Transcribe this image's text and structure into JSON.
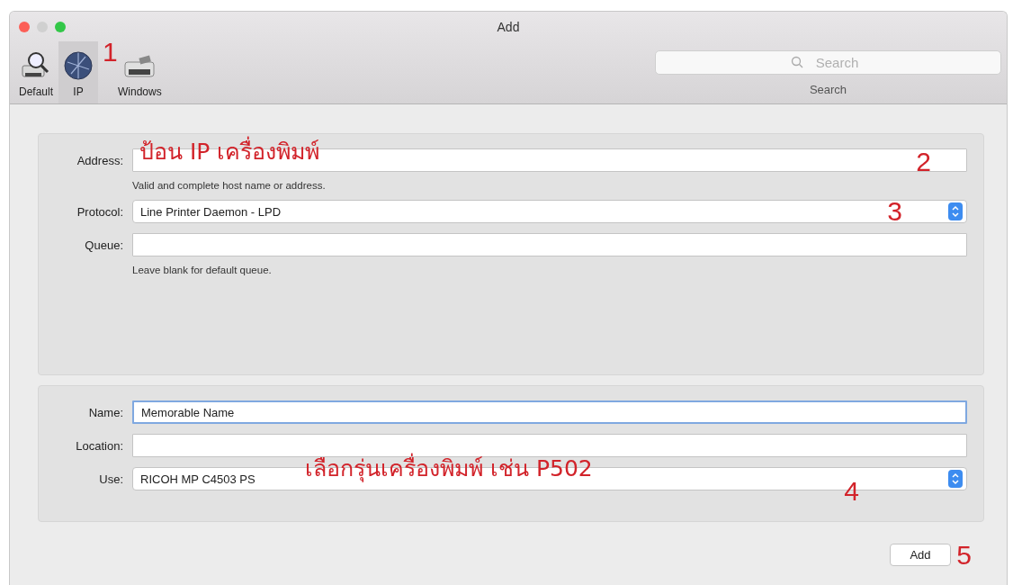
{
  "window": {
    "title": "Add"
  },
  "toolbar": {
    "marker": "1",
    "items": [
      {
        "kind": "default",
        "label": "Default",
        "selected": false
      },
      {
        "kind": "ip",
        "label": "IP",
        "selected": true
      },
      {
        "kind": "windows",
        "label": "Windows",
        "selected": false
      }
    ]
  },
  "search": {
    "placeholder": "Search",
    "label": "Search"
  },
  "connection": {
    "fields": [
      {
        "kind": "text",
        "label": "Address:",
        "focused": false,
        "hint": "Valid and complete host name or address.",
        "note": "ป้อน IP เครื่องพิมพ์",
        "marker": "2"
      },
      {
        "kind": "select",
        "label": "Protocol:",
        "value": "Line Printer Daemon - LPD",
        "focused": false,
        "marker": "3"
      },
      {
        "kind": "text",
        "label": "Queue:",
        "focused": false,
        "hint": "Leave blank for default queue."
      }
    ]
  },
  "details": {
    "fields": [
      {
        "kind": "text",
        "label": "Name:",
        "value": "Memorable Name",
        "focused": true
      },
      {
        "kind": "text",
        "label": "Location:",
        "focused": false
      },
      {
        "kind": "select",
        "label": "Use:",
        "value": "RICOH MP C4503 PS",
        "focused": false,
        "note": "เลือกรุ่นเครื่องพิมพ์ เช่น P502",
        "marker": "4"
      }
    ]
  },
  "add_button": {
    "label": "Add",
    "marker": "5"
  }
}
